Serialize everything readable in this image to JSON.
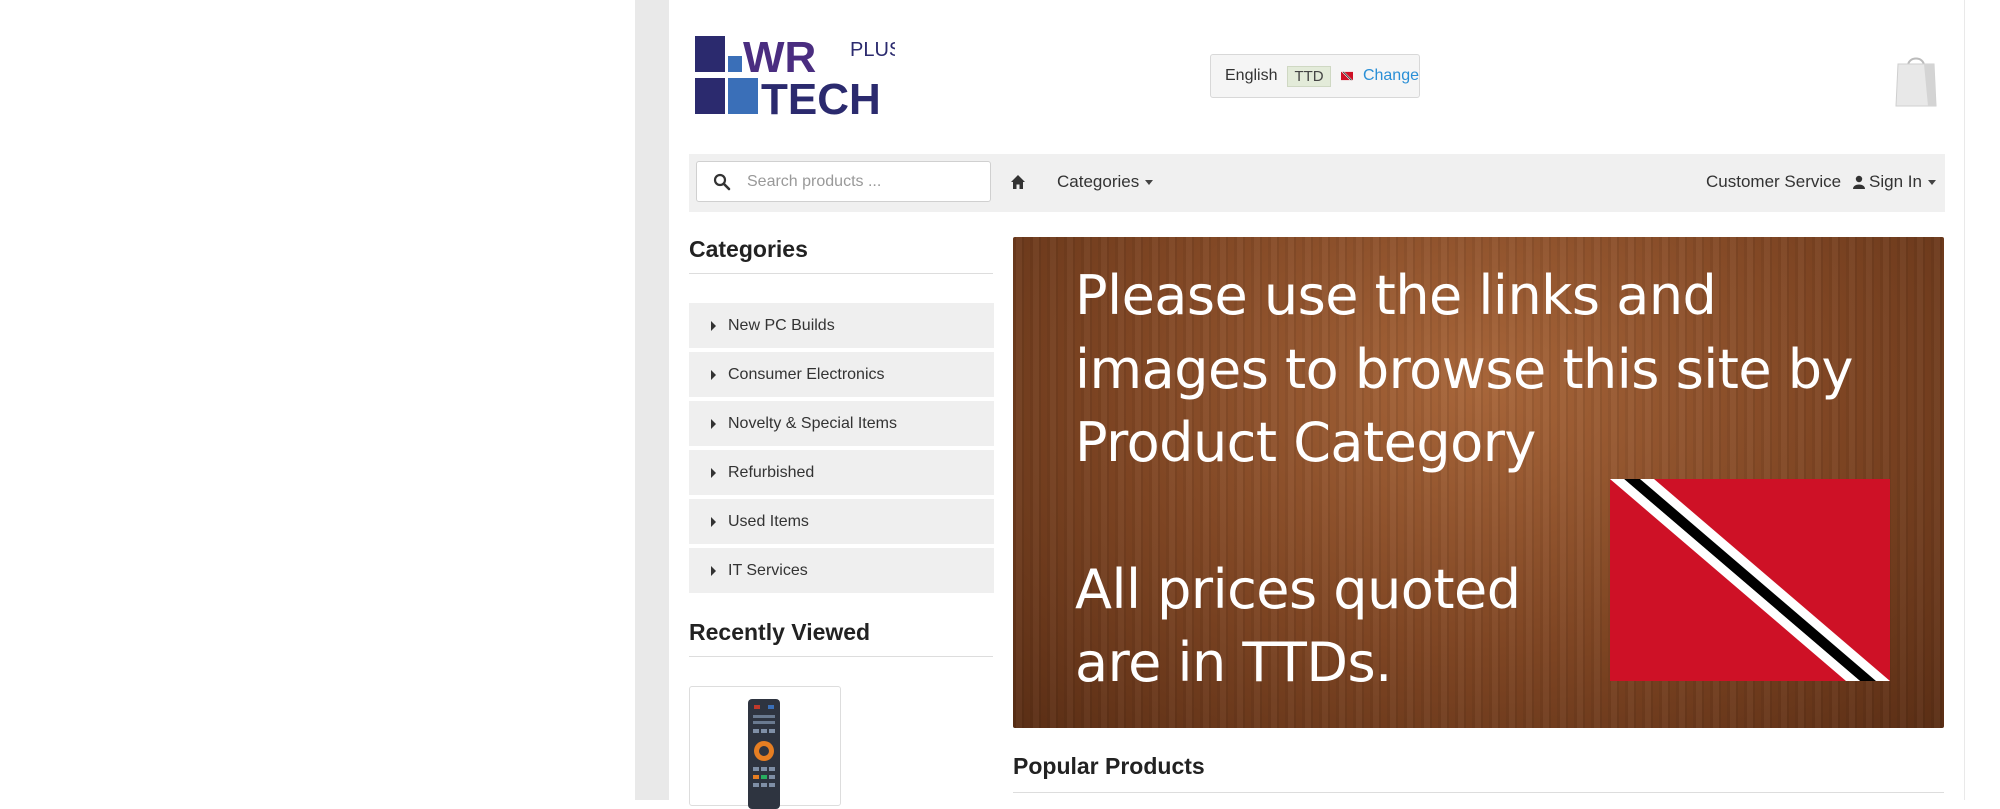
{
  "header": {
    "logo": {
      "line1": "WR",
      "line2": "TECH",
      "plus": "PLUS"
    },
    "language": "English",
    "currency": "TTD",
    "change_label": "Change"
  },
  "nav": {
    "search_placeholder": "Search products ...",
    "categories_label": "Categories",
    "customer_service_label": "Customer Service",
    "sign_in_label": "Sign In"
  },
  "sidebar": {
    "categories_heading": "Categories",
    "categories": [
      {
        "label": "New PC Builds"
      },
      {
        "label": "Consumer Electronics"
      },
      {
        "label": "Novelty & Special Items"
      },
      {
        "label": "Refurbished"
      },
      {
        "label": "Used Items"
      },
      {
        "label": "IT Services"
      }
    ],
    "recently_viewed_heading": "Recently Viewed"
  },
  "banner": {
    "lines": [
      "Please use the links and",
      "images to browse this site by",
      "Product Category",
      "All prices quoted",
      "are in TTDs."
    ]
  },
  "main": {
    "popular_heading": "Popular Products"
  },
  "colors": {
    "flag_red": "#ce1126",
    "flag_black": "#000000",
    "logo_navy": "#2b2a6e",
    "logo_purple": "#4a2d80",
    "link_blue": "#2a8fd6"
  }
}
